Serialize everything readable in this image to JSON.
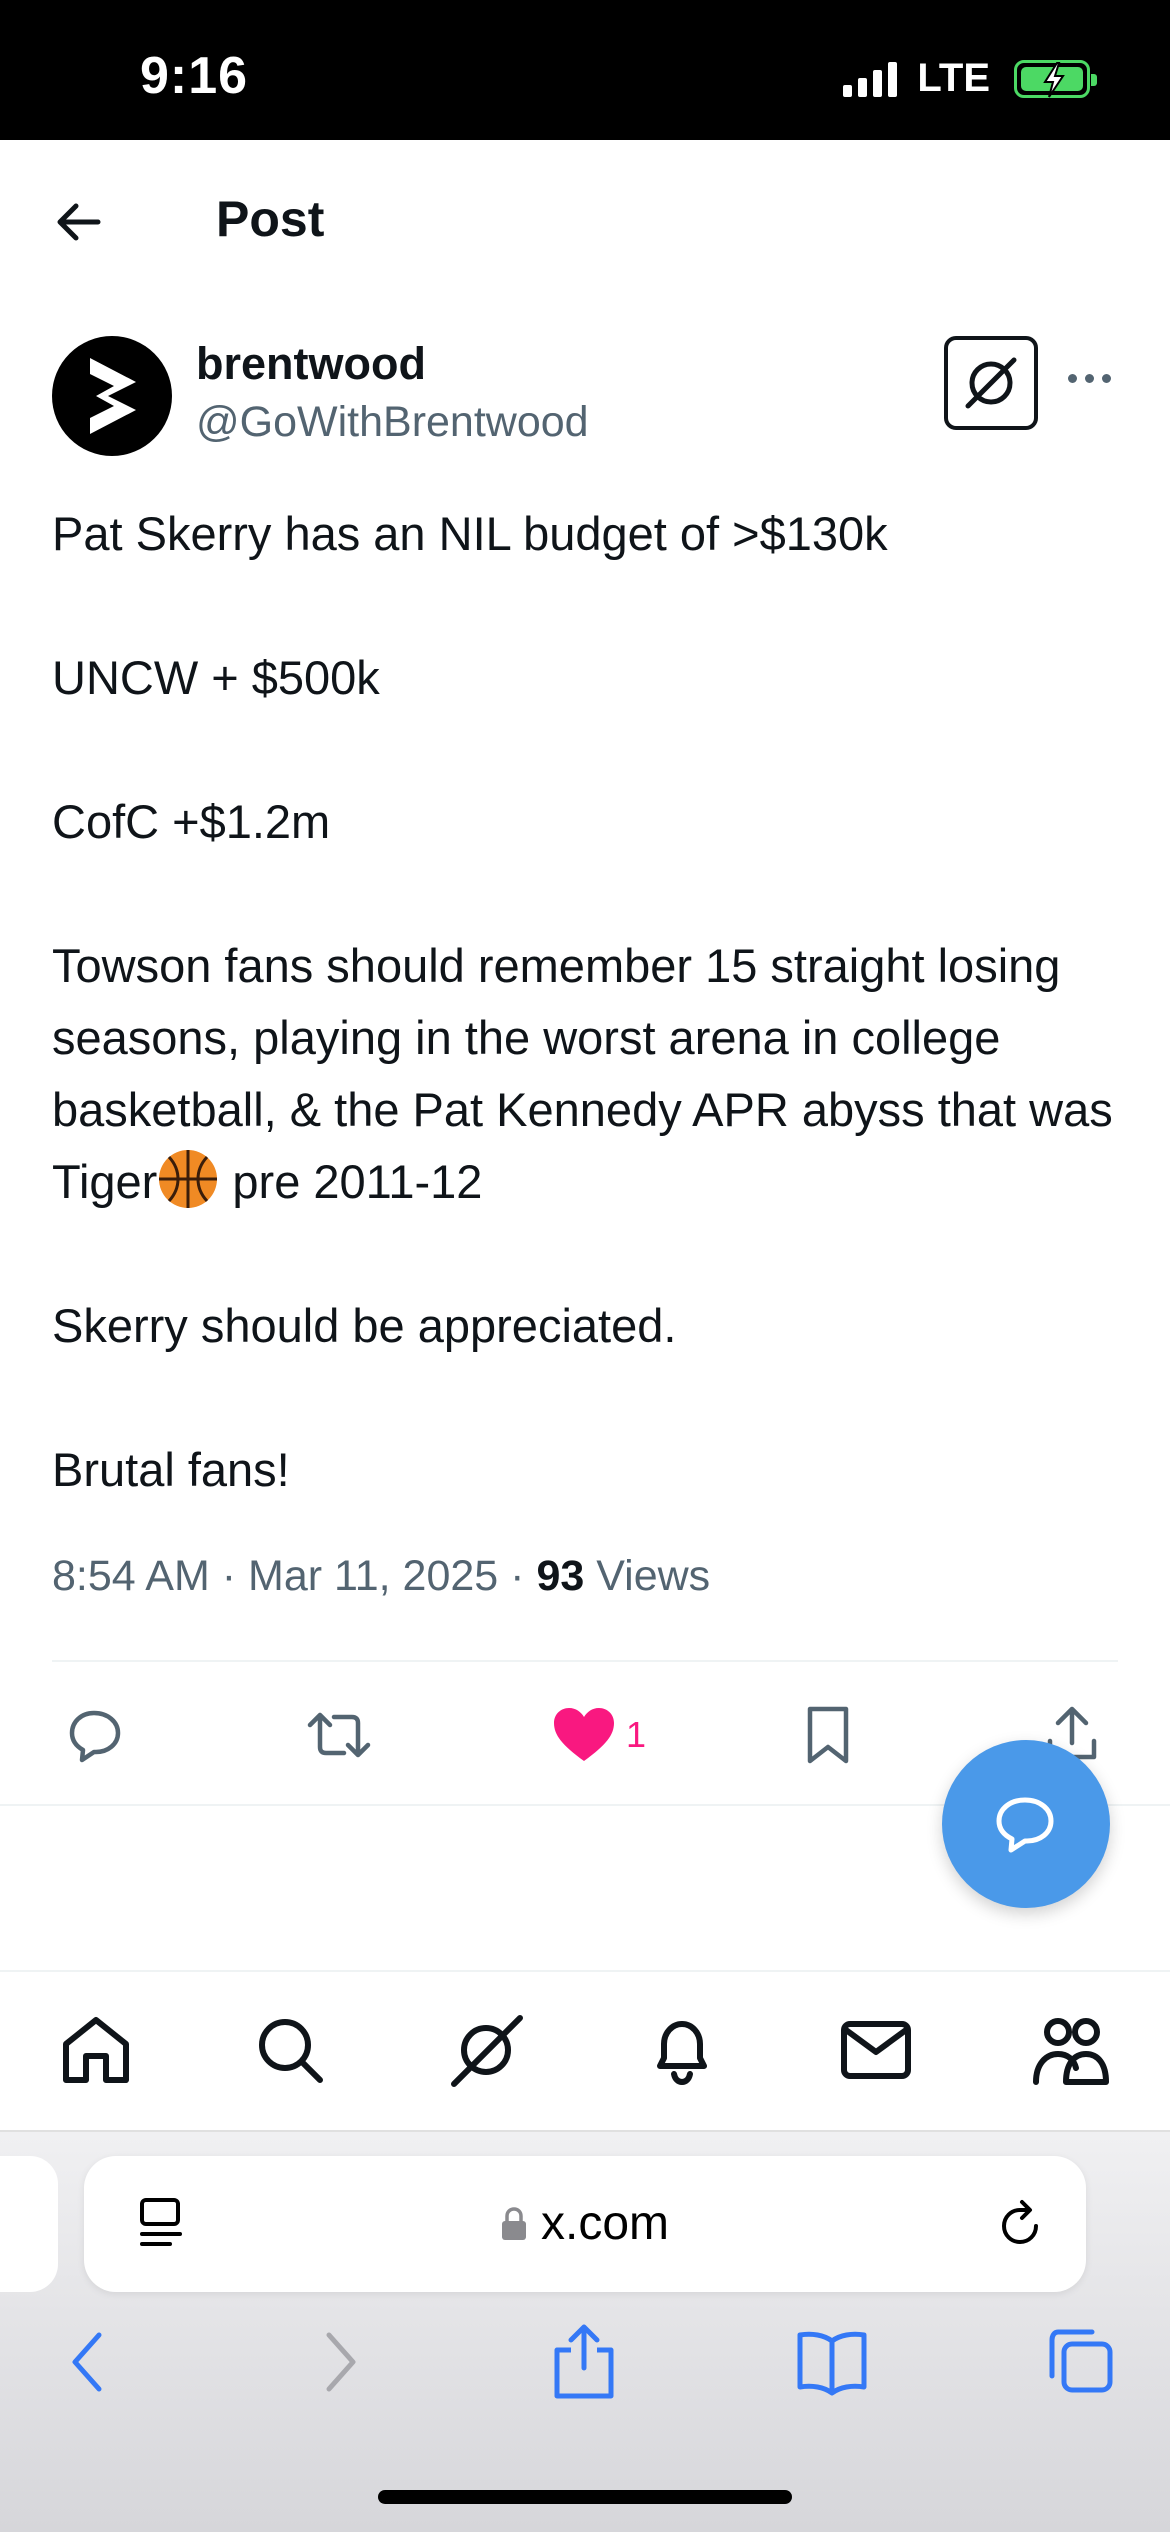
{
  "status_bar": {
    "time": "9:16",
    "network": "LTE"
  },
  "header": {
    "title": "Post"
  },
  "post": {
    "author_name": "brentwood",
    "author_handle": "@GoWithBrentwood",
    "lines": {
      "l1": "Pat Skerry has an NIL budget of >$130k",
      "l2": "UNCW + $500k",
      "l3": "CofC +$1.2m",
      "l4a": "Towson fans should remember 15 straight losing seasons, playing in the worst arena in college basketball, & the Pat Kennedy APR abyss that was Tiger",
      "l4b": " pre 2011-12",
      "l5": "Skerry should be appreciated.",
      "l6": "Brutal fans!"
    },
    "time": "8:54 AM",
    "separator": "·",
    "date": "Mar 11, 2025",
    "views_count": "93",
    "views_label": "Views"
  },
  "actions": {
    "like_count": "1"
  },
  "browser": {
    "url": "x.com"
  },
  "colors": {
    "like": "#f91880",
    "fab": "#4a99e9",
    "safari_blue": "#3478f6"
  }
}
